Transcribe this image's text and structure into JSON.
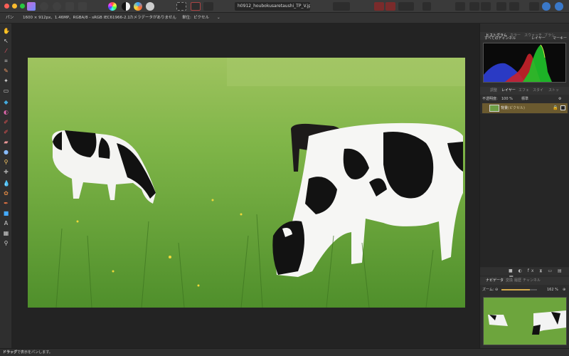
{
  "toolbar": {
    "document_title": "h0912_houbokusaretaushi_TP_V.jpg (161.8"
  },
  "context_bar": {
    "tool": "パン",
    "image_info": "1600 × 912px、1.46MP、RGBA/8 - sRGB IEC61966-2.1",
    "camera": "カメラデータがありません",
    "unit_label": "単位:",
    "unit_value": "ピクセル"
  },
  "right_panel": {
    "top_tabs": [
      "ヒストグラム",
      "カラー",
      "スウォッチ",
      "ブラシ"
    ],
    "histogram_channel": "すべてのチャンネル",
    "histogram_layer_button": "レイヤー",
    "histogram_marker_button": "マーキー",
    "layer_tabs": [
      "調整",
      "レイヤー",
      "エフェ",
      "スタイ",
      "ストッ"
    ],
    "opacity_label": "不透明度:",
    "opacity_value": "100 %",
    "blend_mode": "標準",
    "layer_name": "背景",
    "layer_type": "(ピクセル)",
    "nav_tabs": [
      "ナビゲータ",
      "変換",
      "履歴",
      "チャンネル"
    ],
    "zoom_label": "ズーム:",
    "zoom_value": "162 %",
    "zoom_fraction": 0.8
  },
  "status_bar": {
    "bold": "ドラッグ",
    "text": "で表示をパンします。"
  },
  "colors": {
    "accent": "#6b5a2f",
    "panel": "#2d2d2d",
    "grass": "#6da53d"
  }
}
